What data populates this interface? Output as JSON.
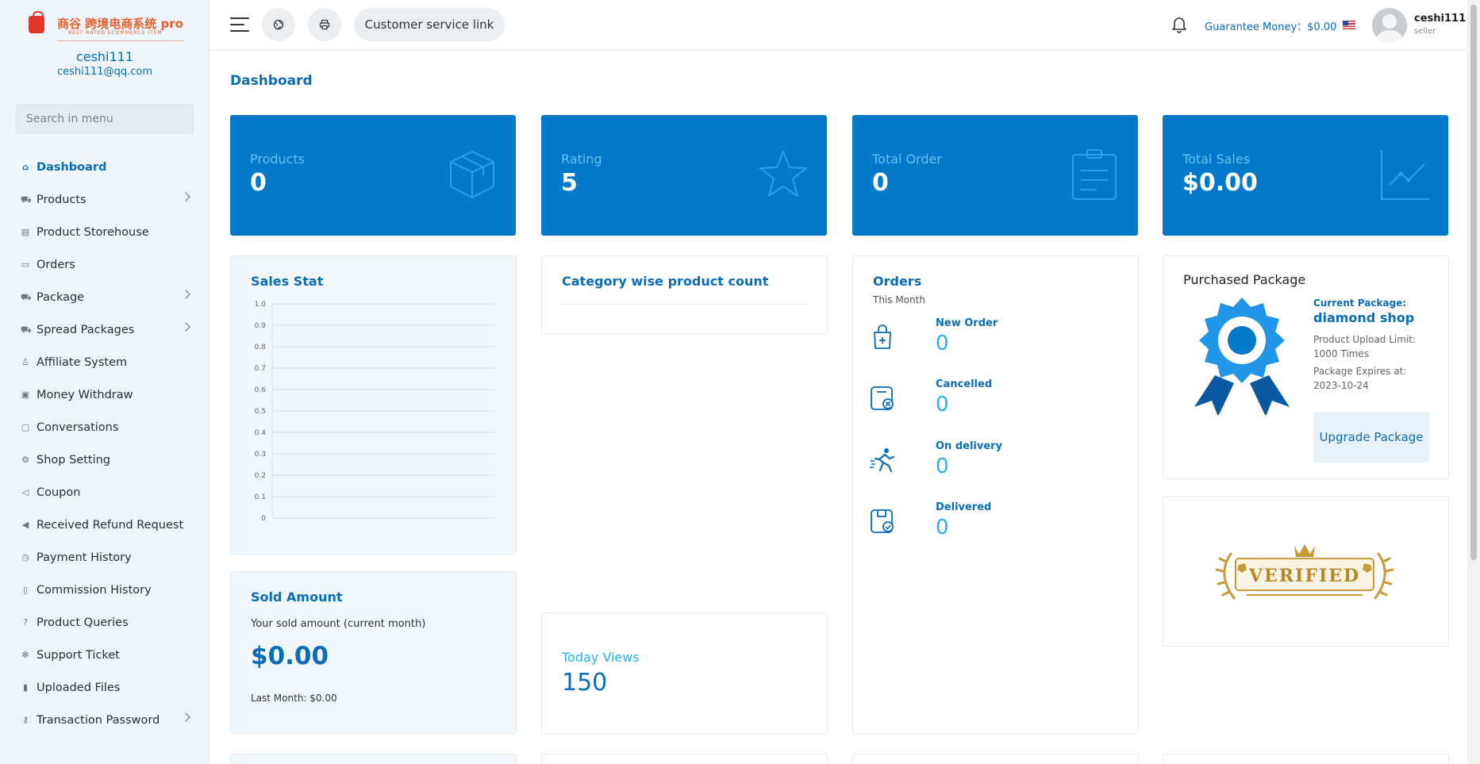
{
  "brand": {
    "name": "商谷 跨境电商系统 pro",
    "tagline": "BEST RATED ECOMMERCE ITEM"
  },
  "user": {
    "name": "ceshi111",
    "email": "ceshi111@qq.com",
    "role": "seller"
  },
  "sidebar": {
    "search_placeholder": "Search in menu",
    "items": [
      {
        "label": "Dashboard",
        "icon": "home-icon",
        "active": true,
        "expandable": false
      },
      {
        "label": "Products",
        "icon": "cart-icon",
        "active": false,
        "expandable": true
      },
      {
        "label": "Product Storehouse",
        "icon": "storehouse-icon",
        "active": false,
        "expandable": false
      },
      {
        "label": "Orders",
        "icon": "orders-icon",
        "active": false,
        "expandable": false
      },
      {
        "label": "Package",
        "icon": "cart-icon",
        "active": false,
        "expandable": true
      },
      {
        "label": "Spread Packages",
        "icon": "cart-icon",
        "active": false,
        "expandable": true
      },
      {
        "label": "Affiliate System",
        "icon": "user-icon",
        "active": false,
        "expandable": false
      },
      {
        "label": "Money Withdraw",
        "icon": "money-icon",
        "active": false,
        "expandable": false
      },
      {
        "label": "Conversations",
        "icon": "chat-icon",
        "active": false,
        "expandable": false
      },
      {
        "label": "Shop Setting",
        "icon": "gear-icon",
        "active": false,
        "expandable": false
      },
      {
        "label": "Coupon",
        "icon": "megaphone-icon",
        "active": false,
        "expandable": false
      },
      {
        "label": "Received Refund Request",
        "icon": "refund-icon",
        "active": false,
        "expandable": false
      },
      {
        "label": "Payment History",
        "icon": "history-icon",
        "active": false,
        "expandable": false
      },
      {
        "label": "Commission History",
        "icon": "file-icon",
        "active": false,
        "expandable": false
      },
      {
        "label": "Product Queries",
        "icon": "question-icon",
        "active": false,
        "expandable": false
      },
      {
        "label": "Support Ticket",
        "icon": "support-icon",
        "active": false,
        "expandable": false
      },
      {
        "label": "Uploaded Files",
        "icon": "folder-icon",
        "active": false,
        "expandable": false
      },
      {
        "label": "Transaction Password",
        "icon": "key-icon",
        "active": false,
        "expandable": true
      }
    ]
  },
  "header": {
    "customer_service_label": "Customer service link",
    "guarantee_label": "Guarantee Money：",
    "guarantee_value": "$0.00"
  },
  "page_title": "Dashboard",
  "stats": [
    {
      "label": "Products",
      "value": "0",
      "icon": "box-icon"
    },
    {
      "label": "Rating",
      "value": "5",
      "icon": "star-icon"
    },
    {
      "label": "Total Order",
      "value": "0",
      "icon": "clipboard-icon"
    },
    {
      "label": "Total Sales",
      "value": "$0.00",
      "icon": "trend-icon"
    }
  ],
  "sales_stat": {
    "title": "Sales Stat",
    "chart_data": {
      "type": "line",
      "title": "Sales Stat",
      "y_ticks": [
        "1.0",
        "0.9",
        "0.8",
        "0.7",
        "0.6",
        "0.5",
        "0.4",
        "0.3",
        "0.2",
        "0.1",
        "0"
      ],
      "ylim": [
        0,
        1
      ],
      "grid": true,
      "series": []
    }
  },
  "category_card": {
    "title": "Category wise product count"
  },
  "orders_card": {
    "title": "Orders",
    "subtitle": "This Month",
    "rows": [
      {
        "label": "New Order",
        "value": "0",
        "icon": "bag-plus-icon"
      },
      {
        "label": "Cancelled",
        "value": "0",
        "icon": "cancel-box-icon"
      },
      {
        "label": "On delivery",
        "value": "0",
        "icon": "runner-icon"
      },
      {
        "label": "Delivered",
        "value": "0",
        "icon": "check-box-icon"
      }
    ]
  },
  "package_card": {
    "title": "Purchased Package",
    "current_label": "Current Package:",
    "current_name": "diamond shop",
    "upload_limit": "Product Upload Limit: 1000 Times",
    "expires": "Package Expires at: 2023-10-24",
    "upgrade_label": "Upgrade Package"
  },
  "verified_badge": {
    "text": "VERIFIED"
  },
  "sold_amount": {
    "title": "Sold Amount",
    "subtitle": "Your sold amount (current month)",
    "value": "$0.00",
    "last_month": "Last Month: $0.00"
  },
  "today_views": {
    "label": "Today Views",
    "value": "150"
  },
  "colors": {
    "primary": "#0478c9",
    "accent": "#2ab0e8",
    "sidebar_bg": "#eef5fb"
  }
}
